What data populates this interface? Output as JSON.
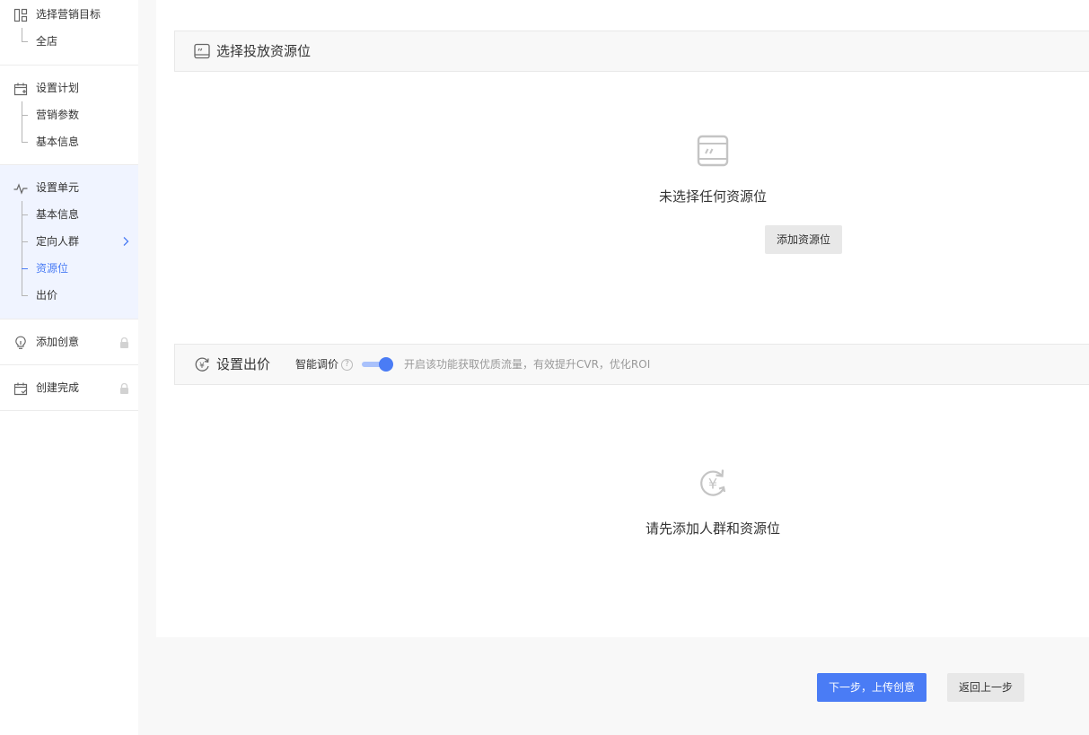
{
  "sidebar": {
    "goal": {
      "title": "选择营销目标",
      "items": [
        "全店"
      ]
    },
    "plan": {
      "title": "设置计划",
      "items": [
        "营销参数",
        "基本信息"
      ]
    },
    "unit": {
      "title": "设置单元",
      "items": [
        "基本信息",
        "定向人群",
        "资源位",
        "出价"
      ],
      "active_item": "资源位"
    },
    "creative": {
      "title": "添加创意",
      "locked": true
    },
    "done": {
      "title": "创建完成",
      "locked": true
    }
  },
  "resource_section": {
    "title": "选择投放资源位",
    "empty_text": "未选择任何资源位",
    "add_button": "添加资源位"
  },
  "bid_section": {
    "title": "设置出价",
    "smart_label": "智能调价",
    "help_icon": "?",
    "smart_enabled": true,
    "hint": "开启该功能获取优质流量，有效提升CVR，优化ROI",
    "empty_text": "请先添加人群和资源位"
  },
  "footer": {
    "next_button": "下一步，上传创意",
    "back_button": "返回上一步"
  },
  "colors": {
    "accent": "#4a7cf5",
    "active_bg": "#f0f4ff",
    "gray_button": "#e8e8e8"
  }
}
